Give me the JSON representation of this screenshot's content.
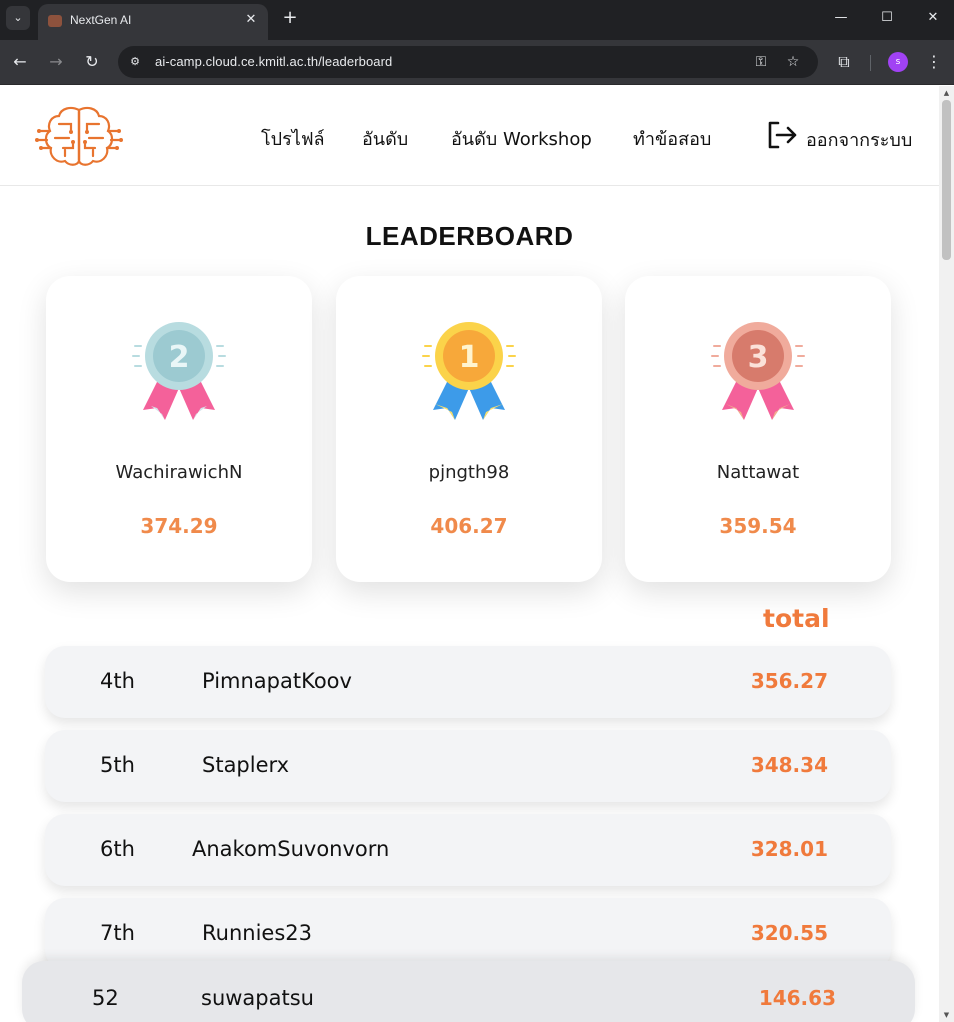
{
  "browser": {
    "tab_title": "NextGen AI",
    "url": "ai-camp.cloud.ce.kmitl.ac.th/leaderboard",
    "profile_initial": "s"
  },
  "nav": {
    "profile": "โปรไฟล์",
    "ranking": "อันดับ",
    "workshop_ranking": "อันดับ Workshop",
    "exam": "ทำข้อสอบ",
    "logout": "ออกจากระบบ"
  },
  "page": {
    "title": "LEADERBOARD",
    "total_label": "total"
  },
  "podium": [
    {
      "place": 2,
      "name": "WachirawichN",
      "score": "374.29",
      "medal_color": "#b8dce0",
      "ribbon_color": "#f4619a"
    },
    {
      "place": 1,
      "name": "pjngth98",
      "score": "406.27",
      "medal_color": "#fbbf3a",
      "ribbon_color": "#3d9be9"
    },
    {
      "place": 3,
      "name": "Nattawat",
      "score": "359.54",
      "medal_color": "#e59b8b",
      "ribbon_color": "#f4619a"
    }
  ],
  "rankings": [
    {
      "pos": "4th",
      "name": "PimnapatKoov",
      "score": "356.27"
    },
    {
      "pos": "5th",
      "name": "Staplerx",
      "score": "348.34"
    },
    {
      "pos": "6th",
      "name": "AnakomSuvonvorn",
      "score": "328.01"
    },
    {
      "pos": "7th",
      "name": "Runnies23",
      "score": "320.55"
    }
  ],
  "current_user": {
    "pos": "52",
    "name": "suwapatsu",
    "score": "146.63"
  },
  "colors": {
    "accent": "#f07a3c",
    "row_bg": "#f3f4f6",
    "logo": "#e8742f"
  }
}
